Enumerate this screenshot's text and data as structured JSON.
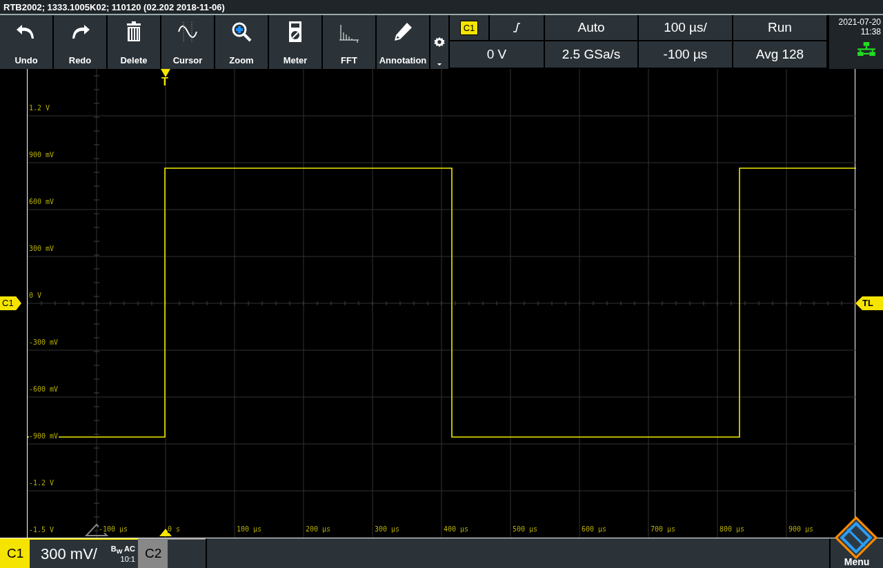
{
  "title_bar": {
    "title": "RTB2002; 1333.1005K02; 110120 (02.202 2018-11-06)"
  },
  "toolbar": {
    "buttons": [
      {
        "label": "Undo",
        "kind": "undo"
      },
      {
        "label": "Redo",
        "kind": "redo"
      },
      {
        "label": "Delete",
        "kind": "delete"
      },
      {
        "label": "Cursor",
        "kind": "cursor"
      },
      {
        "label": "Zoom",
        "kind": "zoom"
      },
      {
        "label": "Meter",
        "kind": "meter"
      },
      {
        "label": "FFT",
        "kind": "fft"
      },
      {
        "label": "Annotation",
        "kind": "annotation"
      }
    ]
  },
  "status": {
    "trigger_source": "C1",
    "trigger_mode": "Auto",
    "timebase": "100 µs/",
    "run_state": "Run",
    "trigger_level": "0 V",
    "sample_rate": "2.5 GSa/s",
    "position": "-100 µs",
    "acquisition": "Avg 128",
    "date": "2021-07-20",
    "time": "11:38"
  },
  "plot": {
    "trigger_marker": "T",
    "channel_marker": "C1",
    "trigger_level_marker": "TL",
    "y_labels": [
      "1.2 V",
      "900 mV",
      "600 mV",
      "300 mV",
      "0 V",
      "-300 mV",
      "-600 mV",
      "-900 mV",
      "-1.2 V",
      "-1.5 V"
    ],
    "x_labels": [
      "-100 µs",
      "0 s",
      "100 µs",
      "200 µs",
      "300 µs",
      "400 µs",
      "500 µs",
      "600 µs",
      "700 µs",
      "800 µs",
      "900 µs"
    ]
  },
  "channels": [
    {
      "name": "C1",
      "on": true,
      "scale": "300 mV/",
      "coupling": "B$_{W}$ AC",
      "probe": "10:1"
    },
    {
      "name": "C2",
      "on": false
    }
  ],
  "menu": {
    "label": "Menu"
  }
}
